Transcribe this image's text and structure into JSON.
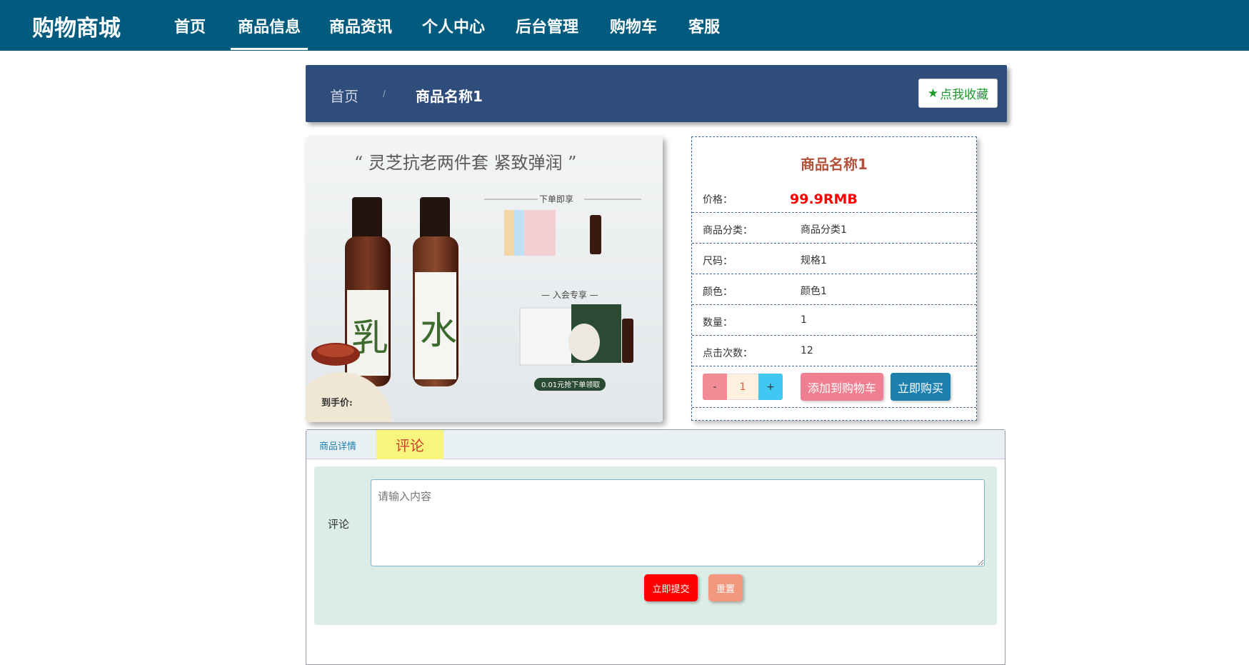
{
  "brand": "购物商城",
  "nav": {
    "items": [
      "首页",
      "商品信息",
      "商品资讯",
      "个人中心",
      "后台管理",
      "购物车",
      "客服"
    ],
    "active": "商品信息"
  },
  "breadcrumb": {
    "home": "首页",
    "separator": "/",
    "current": "商品名称1",
    "favorite_label": "点我收藏"
  },
  "product_image": {
    "title": "“ 灵芝抗老两件套 紧致弹润 ”",
    "gift_heading": "下单即享",
    "member_heading": "— 入会专享 —",
    "bottle1": "乳",
    "bottle2": "水",
    "promo": "0.01元抢下单领取",
    "price_tag": "到手价:"
  },
  "product": {
    "name": "商品名称1",
    "price_label": "价格：",
    "price": "99.9RMB",
    "category_label": "商品分类：",
    "category": "商品分类1",
    "size_label": "尺码：",
    "size": "规格1",
    "color_label": "颜色：",
    "color": "颜色1",
    "quantity_label": "数量：",
    "quantity": "1",
    "clicks_label": "点击次数：",
    "clicks": "12"
  },
  "cart": {
    "minus": "-",
    "qty": "1",
    "plus": "+",
    "add_to_cart": "添加到购物车",
    "buy_now": "立即购买"
  },
  "tabs": {
    "detail": "商品详情",
    "comment": "评论"
  },
  "comment_form": {
    "label": "评论",
    "placeholder": "请输入内容",
    "submit": "立即提交",
    "reset": "重置"
  },
  "colors": {
    "nav_bg": "#005b7f",
    "breadcrumb_bg": "#2e4d7b",
    "price": "#ff0000",
    "title": "#b3513a"
  }
}
